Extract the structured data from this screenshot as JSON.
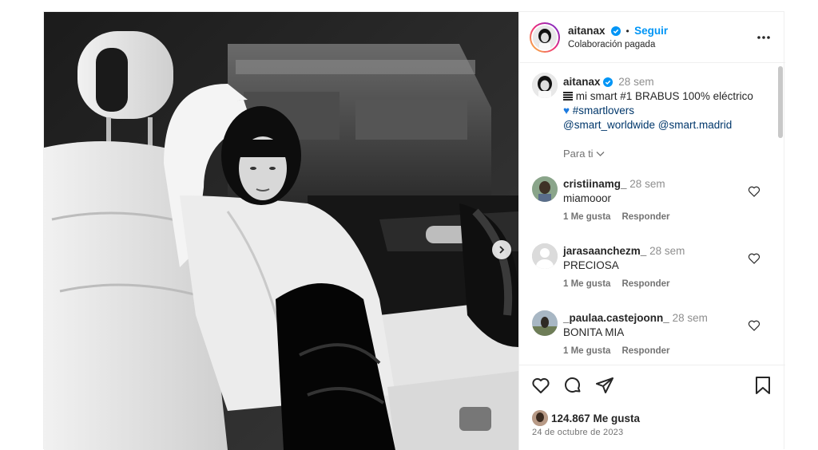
{
  "post": {
    "author": {
      "username": "aitanax",
      "verified": true,
      "follow_label": "Seguir",
      "separator": "•",
      "subtitle": "Colaboración pagada"
    },
    "more_icon": "more-horizontal-icon",
    "caption": {
      "username": "aitanax",
      "age": "28 sem",
      "text_prefix": "mi smart #1 BRABUS 100% eléctrico",
      "hashtag": "#smartlovers",
      "mention1": "@smart_worldwide",
      "mention2": "@smart.madrid",
      "translation_label": "Para ti"
    },
    "comments": [
      {
        "username": "cristiinamg_",
        "age": "28 sem",
        "text": "miamooor",
        "likes_label": "1 Me gusta",
        "reply_label": "Responder"
      },
      {
        "username": "jarasaanchezm_",
        "age": "28 sem",
        "text": "PRECIOSA",
        "likes_label": "1 Me gusta",
        "reply_label": "Responder"
      },
      {
        "username": "_paulaa.castejoonn_",
        "age": "28 sem",
        "text": "BONITA MIA",
        "likes_label": "1 Me gusta",
        "reply_label": "Responder"
      }
    ],
    "likes_count": "124.867 Me gusta",
    "date": "24 de octubre de 2023"
  },
  "colors": {
    "accent": "#0095f6",
    "verified": "#0095f6",
    "text": "#262626",
    "muted": "#737373",
    "link": "#00376b"
  }
}
